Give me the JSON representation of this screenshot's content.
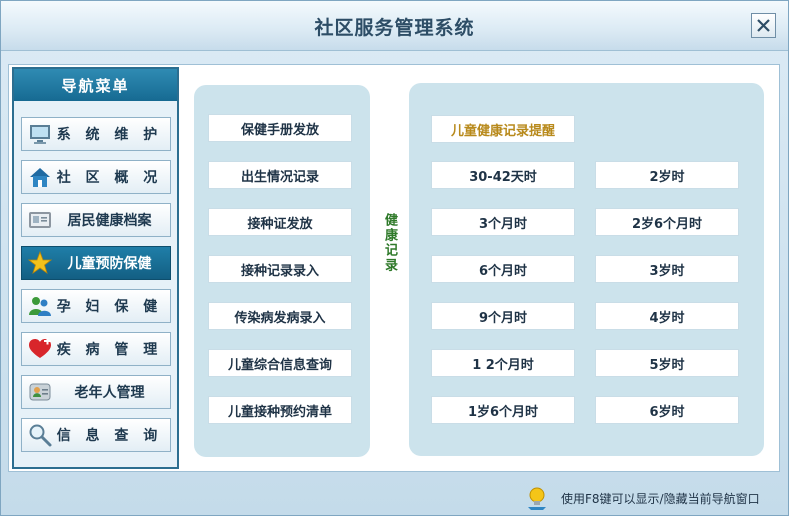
{
  "window": {
    "title": "社区服务管理系统"
  },
  "sidebar": {
    "header": "导航菜单",
    "items": [
      {
        "label": "系 统 维 护",
        "icon": "monitor-icon",
        "active": false
      },
      {
        "label": "社 区 概 况",
        "icon": "house-icon",
        "active": false
      },
      {
        "label": "居民健康档案",
        "icon": "id-card-icon",
        "active": false
      },
      {
        "label": "儿童预防保健",
        "icon": "star-icon",
        "active": true
      },
      {
        "label": "孕 妇 保 健",
        "icon": "people-icon",
        "active": false
      },
      {
        "label": "疾 病 管 理",
        "icon": "heart-icon",
        "active": false
      },
      {
        "label": "老年人管理",
        "icon": "contact-card-icon",
        "active": false
      },
      {
        "label": "信 息 查 询",
        "icon": "magnifier-icon",
        "active": false
      }
    ]
  },
  "left_panel": {
    "buttons": [
      "保健手册发放",
      "出生情况记录",
      "接种证发放",
      "接种记录录入",
      "传染病发病录入",
      "儿童综合信息查询",
      "儿童接种预约清单"
    ]
  },
  "vertical_label": "健康记录",
  "right_panel": {
    "title": "儿童健康记录提醒",
    "left_column": [
      "30-42天时",
      "3个月时",
      "6个月时",
      "9个月时",
      "1 2个月时",
      "1岁6个月时"
    ],
    "right_column": [
      "2岁时",
      "2岁6个月时",
      "3岁时",
      "4岁时",
      "5岁时",
      "6岁时"
    ]
  },
  "status": {
    "text": "使用F8键可以显示/隐藏当前导航窗口"
  },
  "colors": {
    "accent": "#166a92",
    "panel": "#cce3ec",
    "reminder_title": "#b88a1c",
    "vertical_label": "#2f7a2a"
  }
}
